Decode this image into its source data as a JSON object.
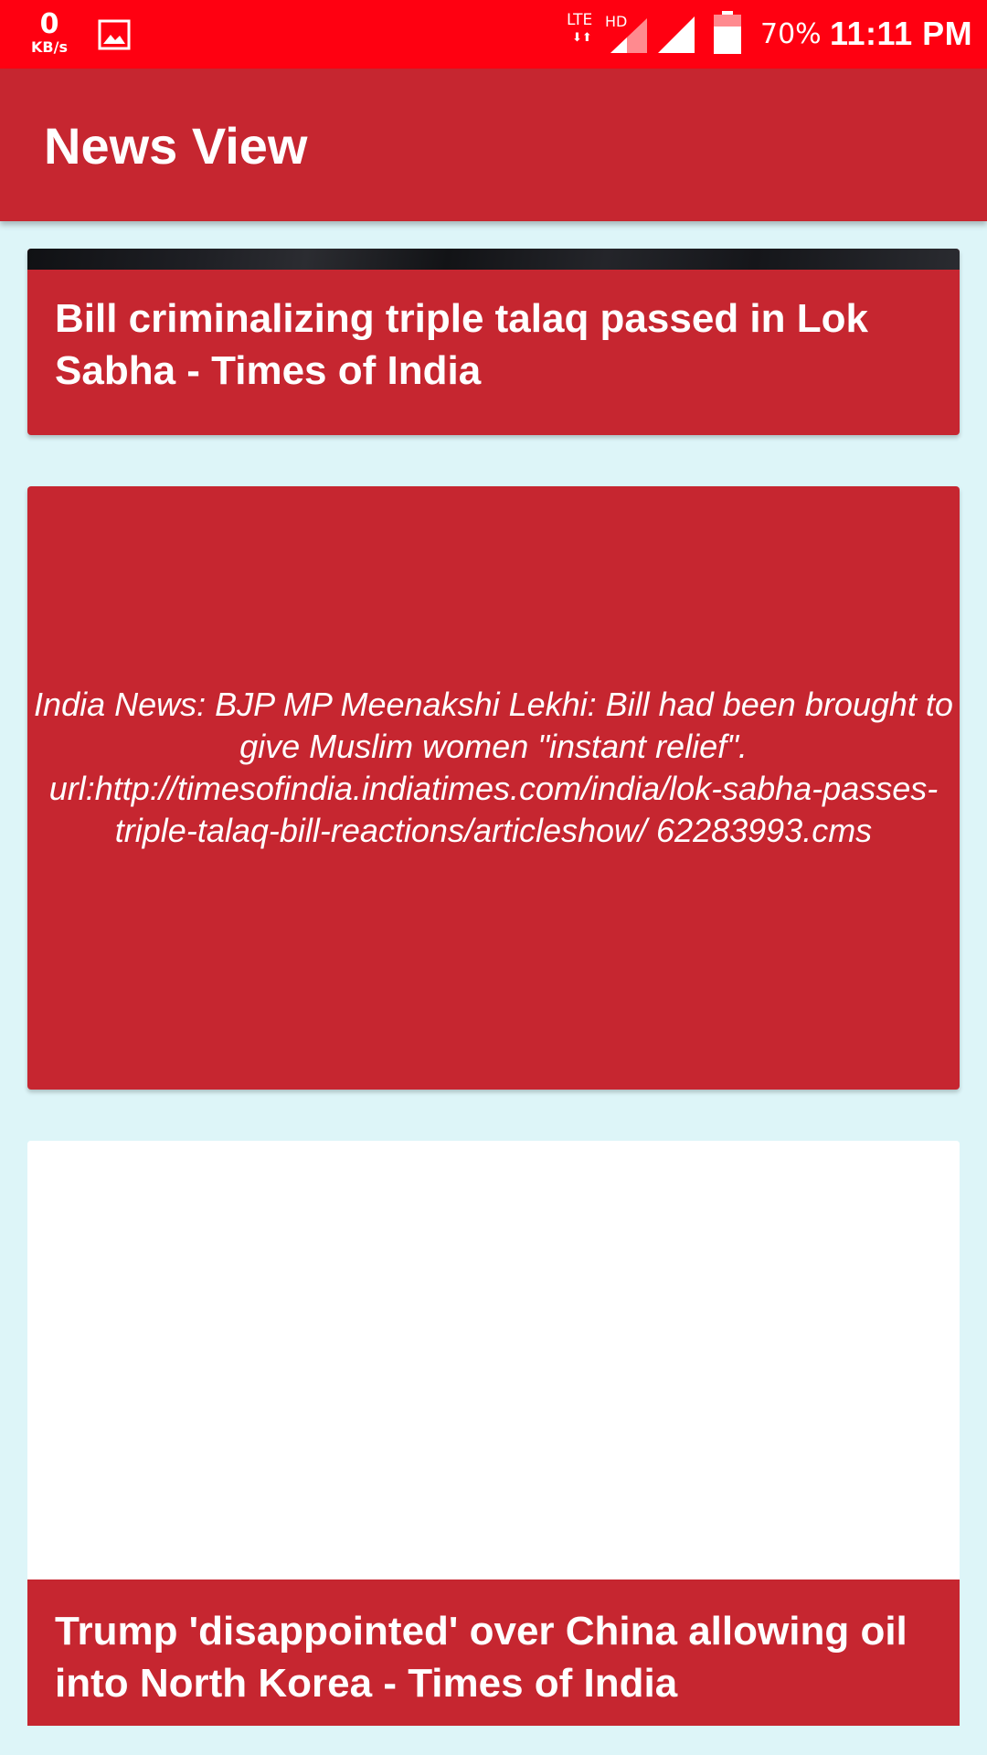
{
  "status_bar": {
    "net_speed_value": "0",
    "net_speed_unit": "KB/s",
    "network_type": "LTE",
    "hd_label": "HD",
    "data_arrows": "⬇⬆",
    "battery_percent": "70%",
    "time": "11:11 PM",
    "icons": [
      "gallery-icon",
      "signal-sim1-icon",
      "signal-sim2-icon",
      "battery-icon"
    ]
  },
  "appbar": {
    "title": "News View"
  },
  "news": [
    {
      "title": "Bill criminalizing triple talaq passed in Lok Sabha - Times of India"
    },
    {
      "description": "India News: BJP MP Meenakshi Lekhi: Bill had been brought to give Muslim women \"instant relief\". url:http://timesofindia.indiatimes.com/india/lok-sabha-passes-triple-talaq-bill-reactions/articleshow/ 62283993.cms"
    },
    {
      "title": "Trump 'disappointed' over China allowing oil into North Korea - Times of India"
    }
  ],
  "colors": {
    "status_bar": "#ff0011",
    "primary": "#c62630",
    "background": "#ddf5f8"
  }
}
